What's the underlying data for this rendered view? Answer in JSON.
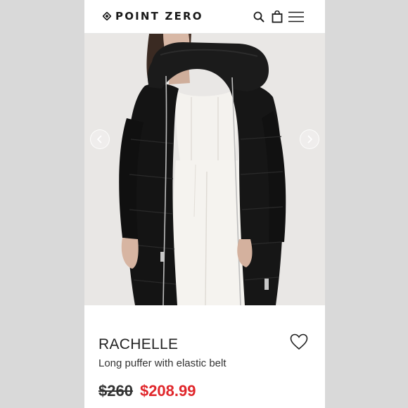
{
  "header": {
    "brand": "POINT ZERO",
    "icons": [
      "diamond-logo-icon",
      "search-icon",
      "shopping-bag-icon",
      "hamburger-menu-icon"
    ]
  },
  "gallery": {
    "prev_icon": "chevron-left-icon",
    "next_icon": "chevron-right-icon"
  },
  "product": {
    "name": "RACHELLE",
    "description": "Long puffer with elastic belt",
    "price_original": "$260",
    "price_sale": "$208.99",
    "wishlist_icon": "heart-outline-icon"
  },
  "colors": {
    "sale_price": "#e0262b",
    "page_background": "#d9d9d9",
    "text": "#222222"
  }
}
